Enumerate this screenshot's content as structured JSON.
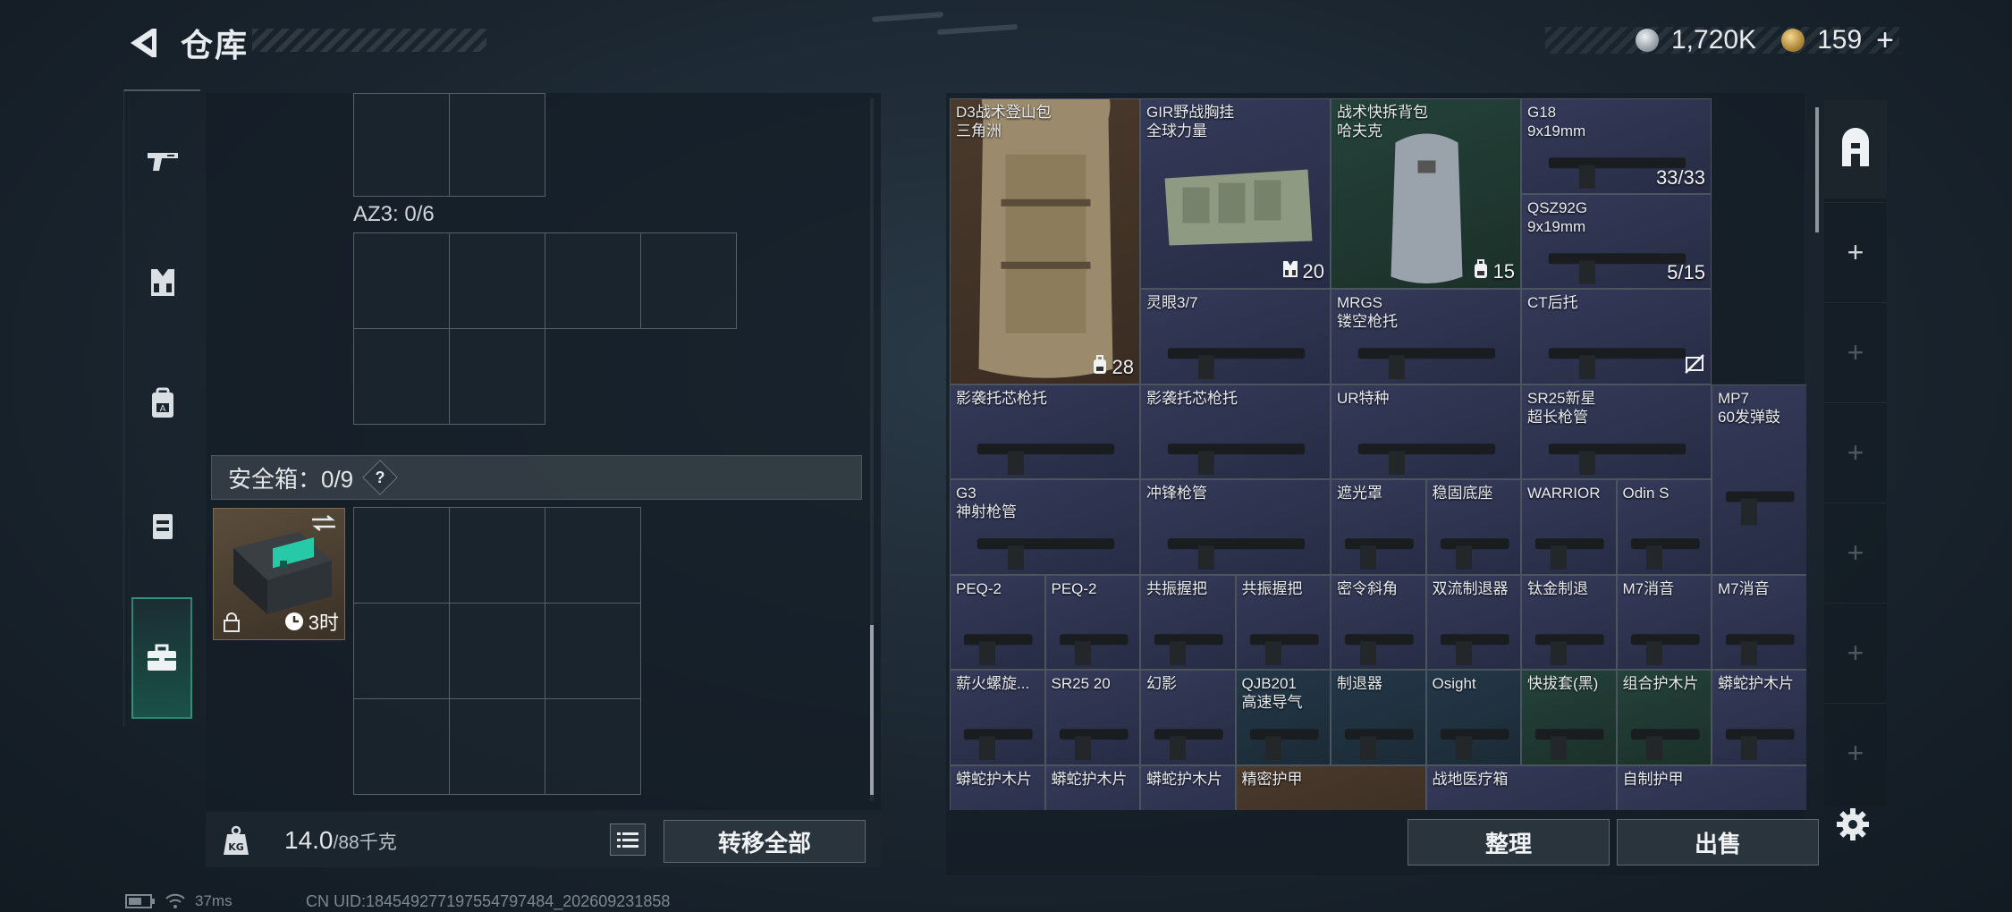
{
  "header": {
    "title": "仓库",
    "coins": [
      {
        "icon": "silver-coin-icon",
        "value": "1,720K"
      },
      {
        "icon": "gold-coin-icon",
        "value": "159"
      }
    ],
    "plus_label": "+"
  },
  "left_nav": [
    {
      "name": "weapon-tab",
      "icon": "pistol-icon"
    },
    {
      "name": "vest-tab",
      "icon": "chest-rig-icon"
    },
    {
      "name": "backpack-tab",
      "icon": "backpack-icon"
    },
    {
      "name": "pouch-tab",
      "icon": "pouch-icon"
    },
    {
      "name": "safe-box-tab",
      "icon": "briefcase-icon",
      "active": true
    }
  ],
  "left_panel": {
    "az3_label": "AZ3: 0/6",
    "safe_box_label": "安全箱：0/9",
    "help_label": "?",
    "safe_item": {
      "timer": "3时",
      "icons": [
        "swap-icon",
        "lock-icon",
        "clock-icon"
      ]
    }
  },
  "weight": {
    "value": "14.0",
    "max": "/88千克"
  },
  "buttons": {
    "transfer_all": "转移全部",
    "sort": "整理",
    "sell": "出售"
  },
  "items": [
    {
      "name": "D3战术登山包\n三角洲",
      "count": "28",
      "count_icon": "backpack-icon",
      "color": "brown"
    },
    {
      "name": "GIR野战胸挂\n全球力量",
      "count": "20",
      "count_icon": "chest-rig-icon",
      "color": "blue"
    },
    {
      "name": "战术快拆背包\n哈夫克",
      "count": "15",
      "count_icon": "backpack-icon",
      "color": "green"
    },
    {
      "name": "G18\n9x19mm",
      "count": "33/33",
      "color": "blue"
    },
    {
      "name": "QSZ92G\n9x19mm",
      "count": "5/15",
      "color": "blue"
    },
    {
      "name": "灵眼3/7",
      "color": "blue"
    },
    {
      "name": "MRGS\n镂空枪托",
      "color": "blue"
    },
    {
      "name": "CT后托",
      "count_icon": "no-use-icon",
      "color": "blue"
    },
    {
      "name": "影袭托芯枪托",
      "color": "blue"
    },
    {
      "name": "影袭托芯枪托",
      "color": "blue"
    },
    {
      "name": "UR特种",
      "color": "blue"
    },
    {
      "name": "SR25新星\n超长枪管",
      "color": "blue"
    },
    {
      "name": "MP7\n60发弹鼓",
      "color": "blue"
    },
    {
      "name": "G3\n神射枪管",
      "color": "blue"
    },
    {
      "name": "冲锋枪管",
      "color": "blue"
    },
    {
      "name": "遮光罩",
      "color": "blue"
    },
    {
      "name": "稳固底座",
      "color": "blue"
    },
    {
      "name": "WARRIOR",
      "color": "blue"
    },
    {
      "name": "Odin S",
      "color": "blue"
    },
    {
      "name": "PEQ-2",
      "color": "blue"
    },
    {
      "name": "PEQ-2",
      "color": "blue"
    },
    {
      "name": "共振握把",
      "color": "blue"
    },
    {
      "name": "共振握把",
      "color": "blue"
    },
    {
      "name": "密令斜角",
      "color": "blue"
    },
    {
      "name": "双流制退器",
      "color": "blue"
    },
    {
      "name": "钛金制退",
      "color": "blue"
    },
    {
      "name": "M7消音",
      "color": "blue"
    },
    {
      "name": "M7消音",
      "color": "blue"
    },
    {
      "name": "薪火螺旋...",
      "color": "blue"
    },
    {
      "name": "SR25 20",
      "color": "blue"
    },
    {
      "name": "幻影",
      "color": "blue"
    },
    {
      "name": "QJB201\n高速导气",
      "color": "teal"
    },
    {
      "name": "制退器",
      "color": "teal"
    },
    {
      "name": "Osight",
      "color": "teal"
    },
    {
      "name": "快拔套(黑)",
      "color": "green"
    },
    {
      "name": "组合护木片",
      "color": "green"
    },
    {
      "name": "蟒蛇护木片",
      "color": "blue"
    },
    {
      "name": "蟒蛇护木片",
      "color": "blue"
    },
    {
      "name": "蟒蛇护木片",
      "color": "blue"
    },
    {
      "name": "蟒蛇护木片",
      "color": "blue"
    },
    {
      "name": "精密护甲",
      "color": "brown"
    },
    {
      "name": "战地医疗箱",
      "color": "blue"
    },
    {
      "name": "自制护甲",
      "color": "blue"
    }
  ],
  "status": {
    "ping": "37ms",
    "uid": "CN UID:1845492771975547974​84_202609231858"
  }
}
